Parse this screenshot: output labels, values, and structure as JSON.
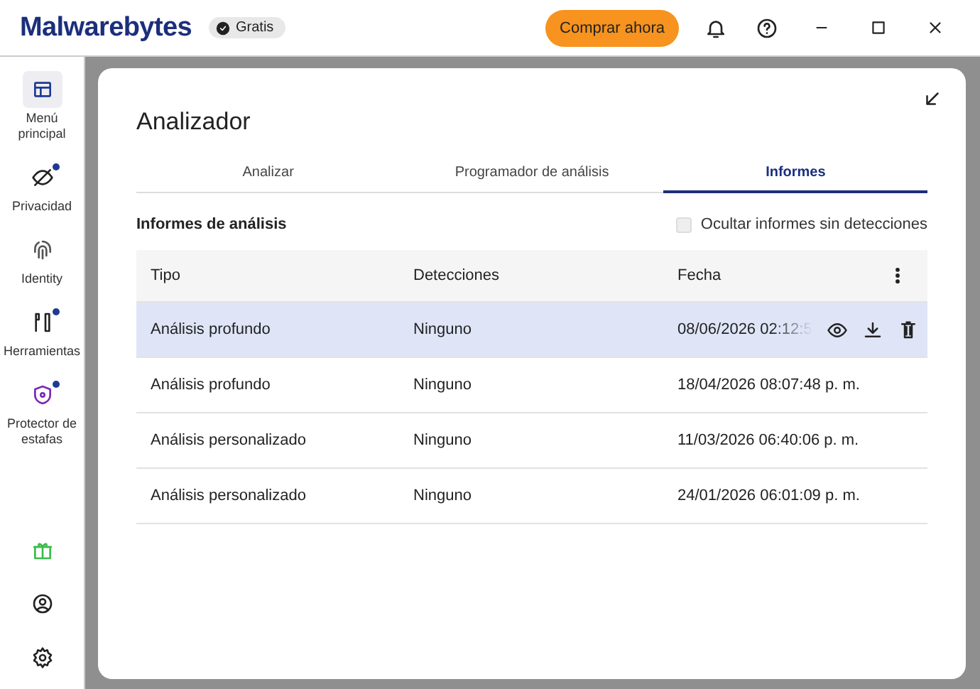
{
  "app": {
    "logo": "Malwarebytes",
    "plan_badge": "Gratis",
    "buy_button": "Comprar ahora"
  },
  "sidebar": {
    "items": [
      {
        "kind": "dashboard",
        "label": "Menú principal",
        "selected": true,
        "badge": false
      },
      {
        "kind": "privacy",
        "label": "Privacidad",
        "selected": false,
        "badge": true
      },
      {
        "kind": "identity",
        "label": "Identity",
        "selected": false,
        "badge": false
      },
      {
        "kind": "tools",
        "label": "Herramientas",
        "selected": false,
        "badge": true
      },
      {
        "kind": "scam",
        "label": "Protector de estafas",
        "selected": false,
        "badge": true
      }
    ],
    "bottom": [
      {
        "kind": "gift"
      },
      {
        "kind": "account"
      },
      {
        "kind": "settings"
      }
    ]
  },
  "dialog": {
    "title": "Analizador",
    "tabs": [
      {
        "label": "Analizar",
        "selected": false
      },
      {
        "label": "Programador de análisis",
        "selected": false
      },
      {
        "label": "Informes",
        "selected": true
      }
    ],
    "section_title": "Informes de análisis",
    "hide_option": {
      "label": "Ocultar informes sin detecciones",
      "checked": false
    },
    "table": {
      "columns": [
        "Tipo",
        "Detecciones",
        "Fecha"
      ],
      "rows": [
        {
          "cells": [
            "Análisis profundo",
            "Ninguno",
            "08/06/2026 02:12:5"
          ],
          "selected": true
        },
        {
          "cells": [
            "Análisis profundo",
            "Ninguno",
            "18/04/2026 08:07:48 p. m."
          ],
          "selected": false
        },
        {
          "cells": [
            "Análisis personalizado",
            "Ninguno",
            "11/03/2026 06:40:06 p. m."
          ],
          "selected": false
        },
        {
          "cells": [
            "Análisis personalizado",
            "Ninguno",
            "24/01/2026 06:01:09 p. m."
          ],
          "selected": false
        }
      ]
    }
  }
}
